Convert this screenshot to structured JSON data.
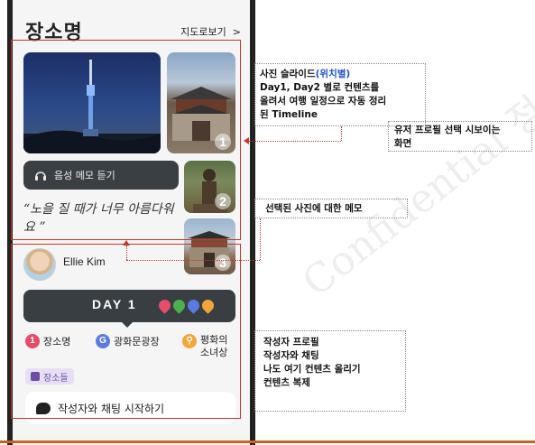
{
  "header": {
    "title": "장소명",
    "map_link": "지도로보기"
  },
  "photos": {
    "badges": [
      "1",
      "2",
      "3"
    ]
  },
  "audio": {
    "label": "음성 메모 듣기"
  },
  "memo": {
    "quote": "“노을 질 때가 너무 아름다워요 ”"
  },
  "author": {
    "name": "Ellie Kim"
  },
  "day": {
    "label": "DAY 1",
    "pins": [
      {
        "n": "1",
        "color": "#e74c6b"
      },
      {
        "n": "2",
        "color": "#4caf50"
      },
      {
        "n": "3",
        "color": "#5b7be0"
      },
      {
        "n": "4",
        "color": "#f4a53a"
      }
    ]
  },
  "places": [
    {
      "n": "1",
      "name": "장소명",
      "color": "#e74c6b"
    },
    {
      "n": "G",
      "name": "광화문광장",
      "color": "#5b7be0"
    },
    {
      "n": "⚲",
      "name": "평화의\n소녀상",
      "color": "#f4a53a"
    }
  ],
  "tag": {
    "label": "장소들"
  },
  "chat": {
    "label": "작성자와 채팅 시작하기"
  },
  "annotations": {
    "slide_title": "사진 슬라이드",
    "slide_title_hl": "(위치별)",
    "slide_l2": "Day1, Day2 별로 컨텐츠를",
    "slide_l3": "올려서 여행 일정으로 자동 정리",
    "slide_l4": "된 Timeline",
    "profile_l1": "유저 프로필 선택 시보이는",
    "profile_l2": "화면",
    "memo_note": "선택된 사진에 대한 메모",
    "author_l1": "작성자 프로필",
    "author_l2": "작성자와 채팅",
    "author_l3": "나도 여기 컨텐츠 올리기",
    "author_l4": "컨텐츠 복제"
  },
  "watermark": "Confidential 정유"
}
